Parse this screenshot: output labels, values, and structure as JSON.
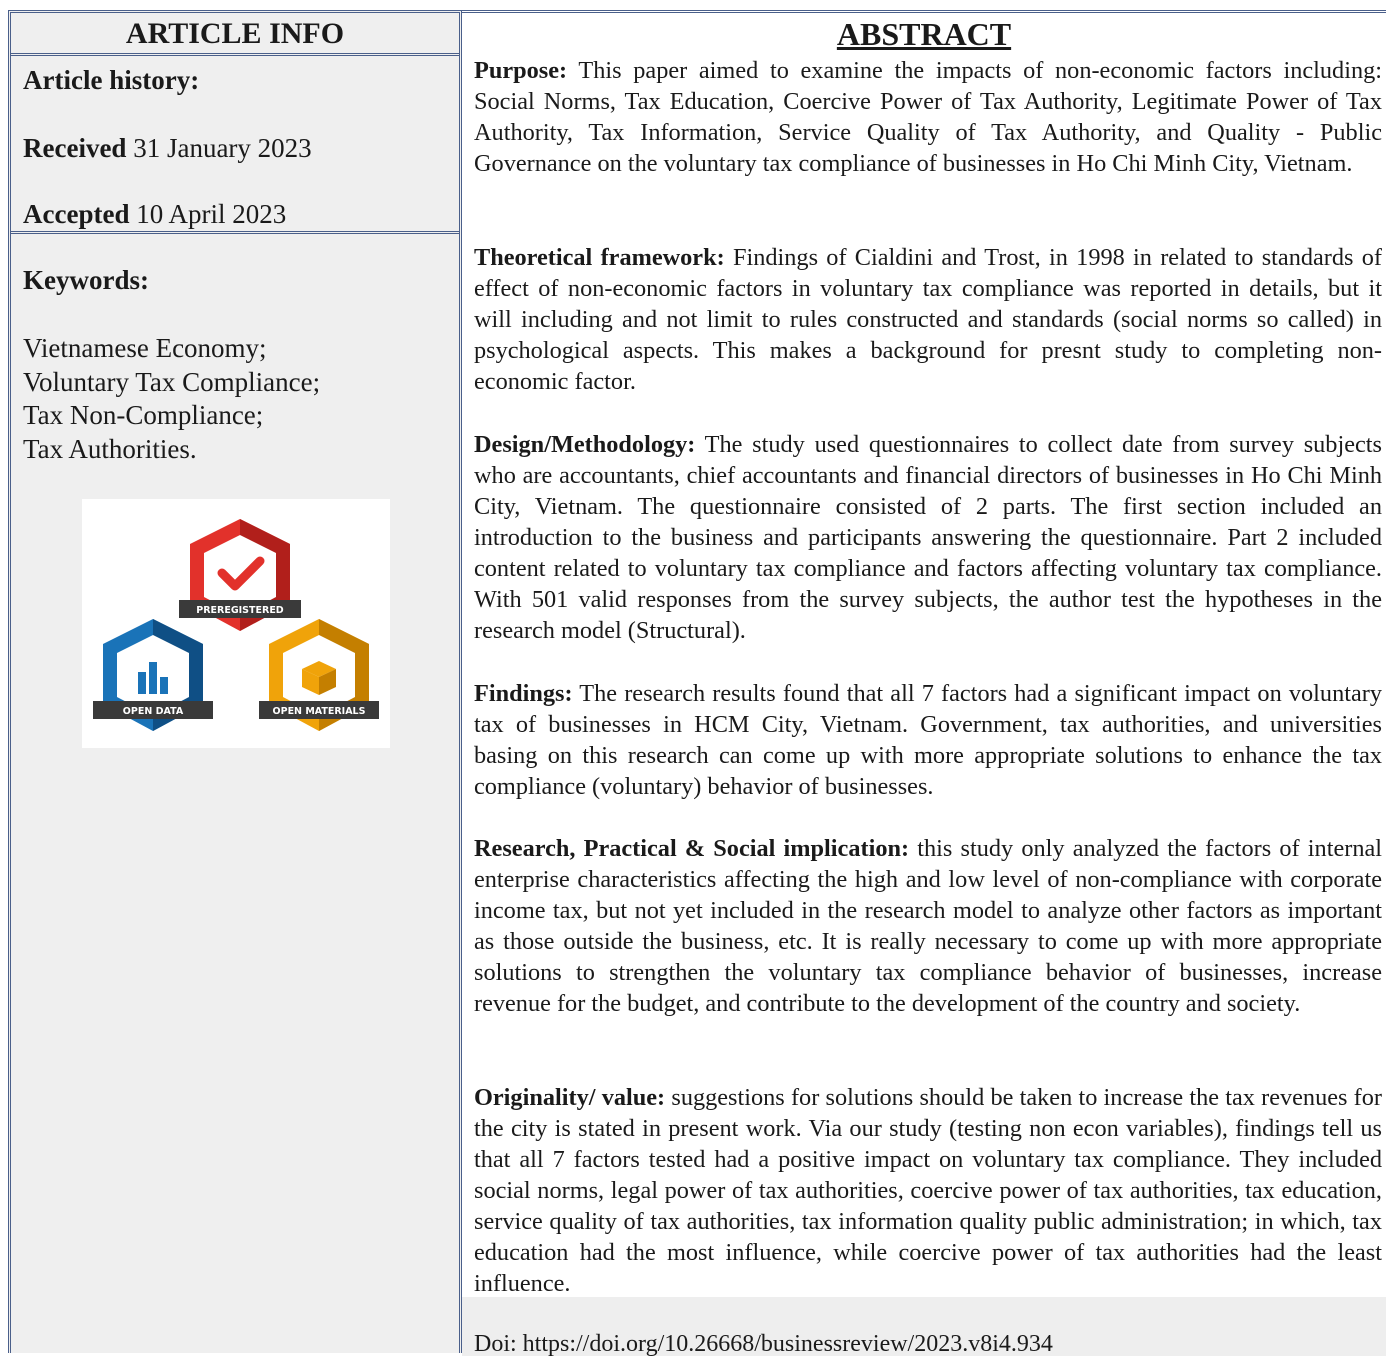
{
  "article_info": {
    "header": "ARTICLE INFO",
    "history_label": "Article history:",
    "received_label": "Received",
    "received_date": "31 January 2023",
    "accepted_label": "Accepted",
    "accepted_date": "10 April 2023",
    "keywords_label": "Keywords:",
    "keywords": [
      "Vietnamese Economy;",
      "Voluntary Tax Compliance;",
      "Tax Non-Compliance;",
      "Tax Authorities."
    ],
    "badges": {
      "preregistered": "PREREGISTERED",
      "open_data": "OPEN DATA",
      "open_materials": "OPEN MATERIALS",
      "colors": {
        "preregistered": "#e2312b",
        "open_data": "#1a73b8",
        "open_materials": "#f0a30a",
        "ribbon": "#3a3a3a"
      }
    }
  },
  "abstract": {
    "header": "ABSTRACT",
    "sections": [
      {
        "heading": "Purpose:",
        "text": "This paper aimed to examine the impacts of non-economic factors including: Social Norms, Tax Education, Coercive Power of Tax Authority, Legitimate Power of Tax Authority, Tax Information, Service Quality of Tax Authority, and Quality - Public Governance on the voluntary tax compliance of businesses in Ho Chi Minh City, Vietnam."
      },
      {
        "heading": "Theoretical framework:",
        "text": "Findings of Cialdini and Trost, in 1998 in related to standards of effect of non-economic factors in voluntary tax compliance was reported in details, but it will including and not limit to rules constructed and standards (social norms so called) in psychological aspects. This makes a background for presnt study to completing non-economic factor."
      },
      {
        "heading": "Design/Methodology:",
        "text": "The study used questionnaires to collect date from survey subjects who are accountants, chief accountants and financial directors of businesses in Ho Chi Minh City, Vietnam. The questionnaire consisted of 2 parts. The first section included an introduction to the business and participants answering the questionnaire. Part 2 included content related to voluntary tax compliance and factors affecting voluntary tax compliance. With 501 valid responses from the survey subjects, the author test the hypotheses in the research model (Structural)."
      },
      {
        "heading": "Findings:",
        "text": "The research results found that all 7 factors had a significant impact on voluntary tax of businesses in HCM City, Vietnam. Government, tax authorities, and universities basing on this research can come up with more appropriate solutions to enhance the tax compliance (voluntary) behavior of businesses."
      },
      {
        "heading": "Research, Practical & Social implication:",
        "text": "this study only analyzed the factors of internal enterprise characteristics affecting the high and low level of non-compliance with corporate income tax, but not yet included in the research model to analyze other factors as important as those outside the business, etc. It is really necessary to come up with more appropriate solutions to strengthen the voluntary tax compliance behavior of businesses, increase revenue for the budget, and contribute to the development of the country and society."
      },
      {
        "heading": "Originality/ value:",
        "text": "suggestions for solutions should be taken to increase the tax revenues for the city is stated in present work. Via our study (testing non econ variables), findings tell us that all 7 factors tested had a positive impact on voluntary tax compliance. They included social norms, legal power of tax authorities, coercive power of tax authorities, tax education, service quality of tax authorities, tax information quality public administration; in which, tax education had the most influence, while coercive power of tax authorities had the least influence."
      }
    ],
    "doi": "Doi: https://doi.org/10.26668/businessreview/2023.v8i4.934"
  }
}
